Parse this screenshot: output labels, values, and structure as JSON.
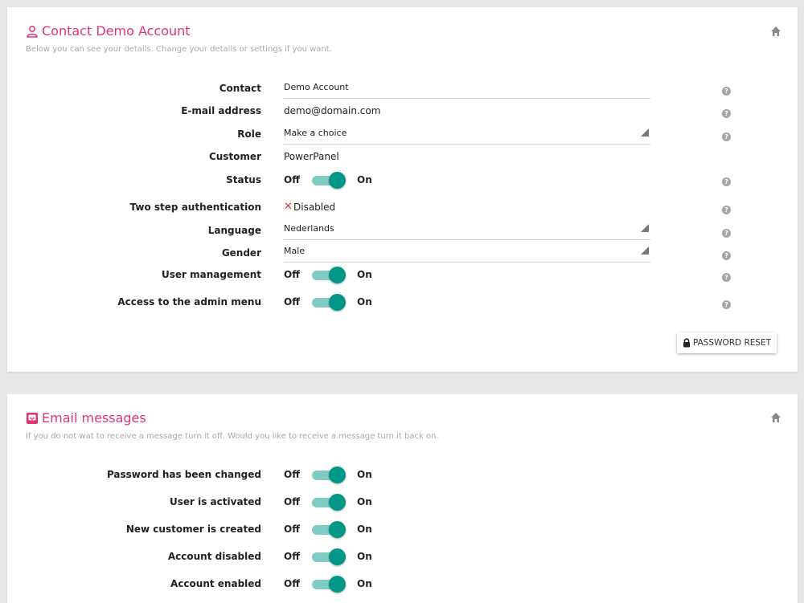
{
  "contact": {
    "title": "Contact Demo Account",
    "subtitle": "Below you can see your details. Change your details or settings if you want.",
    "fields": {
      "contact": {
        "label": "Contact",
        "value": "Demo Account"
      },
      "email": {
        "label": "E-mail address",
        "value": "demo@domain.com"
      },
      "role": {
        "label": "Role",
        "value": "Make a choice"
      },
      "customer": {
        "label": "Customer",
        "value": "PowerPanel"
      },
      "status": {
        "label": "Status",
        "off": "Off",
        "on": "On"
      },
      "two_step": {
        "label": "Two step authentication",
        "mark": "✕",
        "value": "Disabled"
      },
      "language": {
        "label": "Language",
        "value": "Nederlands"
      },
      "gender": {
        "label": "Gender",
        "value": "Male"
      },
      "user_management": {
        "label": "User management",
        "off": "Off",
        "on": "On"
      },
      "admin_menu": {
        "label": "Access to the admin menu",
        "off": "Off",
        "on": "On"
      }
    },
    "password_reset": "PASSWORD RESET",
    "help": "?"
  },
  "email_messages": {
    "title": "Email messages",
    "subtitle": "If you do not wat to receive a message turn it off. Would you like to receive a message turn it back on.",
    "items": [
      {
        "label": "Password has been changed",
        "off": "Off",
        "on": "On"
      },
      {
        "label": "User is activated",
        "off": "Off",
        "on": "On"
      },
      {
        "label": "New customer is created",
        "off": "Off",
        "on": "On"
      },
      {
        "label": "Account disabled",
        "off": "Off",
        "on": "On"
      },
      {
        "label": "Account enabled",
        "off": "Off",
        "on": "On"
      }
    ]
  },
  "colors": {
    "accent": "#e0337a",
    "toggle": "#009688",
    "toggle_track": "#80cbc4",
    "error": "#e53935"
  },
  "icons": {
    "contact": "person-icon",
    "email": "inbox-icon",
    "home": "home-icon",
    "help": "help-icon",
    "lock": "lock-icon",
    "disabled": "close-icon"
  }
}
